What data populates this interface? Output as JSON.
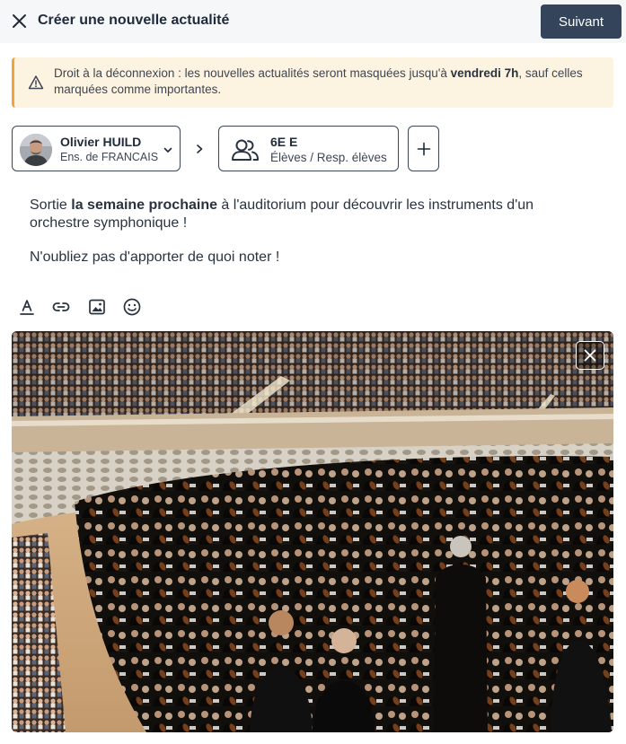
{
  "header": {
    "title": "Créer une nouvelle actualité",
    "next_label": "Suivant",
    "close_icon": "close-icon"
  },
  "warning": {
    "icon": "warning-triangle-icon",
    "text_before": "Droit à la déconnexion : les nouvelles actualités seront masquées jusqu'à ",
    "text_bold": "vendredi 7h",
    "text_after": ", sauf celles marquées comme importantes."
  },
  "author": {
    "name": "Olivier HUILD",
    "role": "Ens. de FRANCAIS"
  },
  "audience": {
    "title": "6E E",
    "subtitle": "Élèves / Resp. élèves"
  },
  "message": {
    "p1_before": "Sortie ",
    "p1_bold": "la semaine prochaine",
    "p1_after": " à l'auditorium pour découvrir les instruments d'un orchestre symphonique !",
    "p2": "N'oubliez pas d'apporter de quoi noter !"
  },
  "toolbar": [
    "text-color-icon",
    "link-icon",
    "image-icon",
    "emoji-icon"
  ],
  "colors": {
    "primary_button": "#34445a",
    "warning_bg": "#fdf3e1",
    "warning_accent": "#f2a33a",
    "border": "#3b4656"
  }
}
